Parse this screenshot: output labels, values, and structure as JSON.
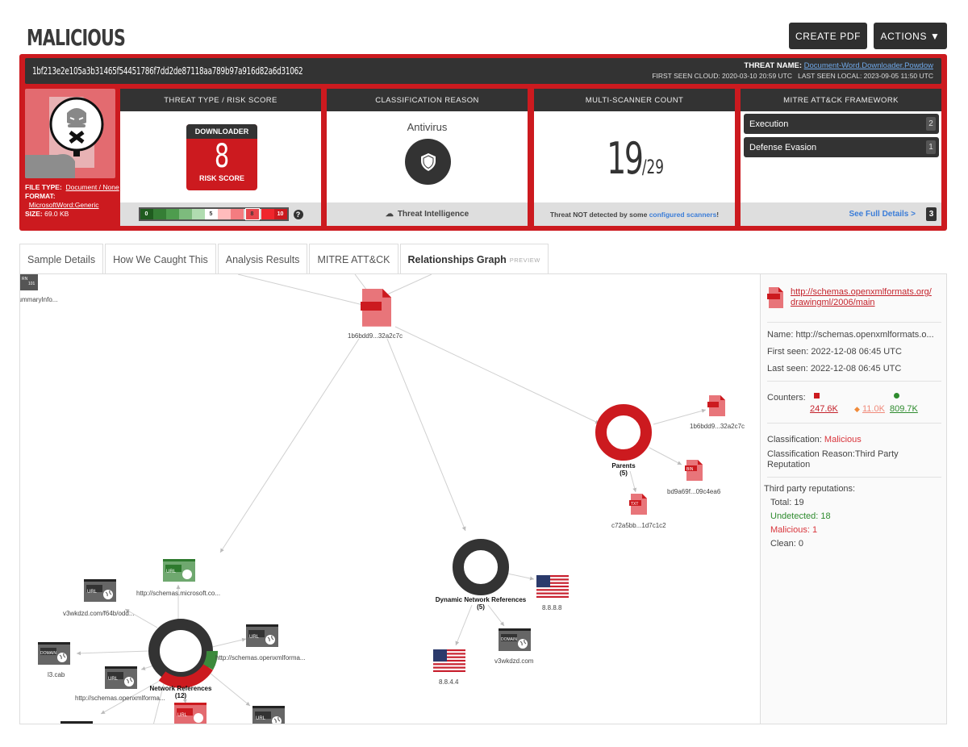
{
  "page": {
    "title": "MALICIOUS",
    "buttons": {
      "create_pdf": "CREATE PDF",
      "actions": "ACTIONS ▼"
    }
  },
  "threat": {
    "hash": "1bf213e2e105a3b31465f54451786f7dd2de87118aa789b97a916d82a6d31062",
    "threat_name_label": "THREAT NAME:",
    "threat_name": "Document-Word.Downloader.Powdow",
    "first_seen": "FIRST SEEN CLOUD: 2020-03-10 20:59 UTC",
    "last_seen": "LAST SEEN LOCAL: 2023-09-05 11:50 UTC",
    "file_type_label": "FILE TYPE:",
    "file_type": "Document / None",
    "format_label": "FORMAT:",
    "format": "MicrosoftWord:Generic",
    "size_label": "SIZE:",
    "size": "69.0 KB"
  },
  "panels": {
    "risk": {
      "header": "THREAT TYPE / RISK SCORE",
      "type": "DOWNLOADER",
      "score": "8",
      "score_label": "RISK SCORE",
      "scale": [
        {
          "label": "0",
          "color": "#1f5c1f"
        },
        {
          "label": "",
          "color": "#357e35"
        },
        {
          "label": "",
          "color": "#4e9c4e"
        },
        {
          "label": "",
          "color": "#7dbb7d"
        },
        {
          "label": "",
          "color": "#b0dcb0"
        },
        {
          "label": "5",
          "color": "#ffffff"
        },
        {
          "label": "",
          "color": "#ffbcbc"
        },
        {
          "label": "",
          "color": "#f47c80"
        },
        {
          "label": "8",
          "color": "#e8474d"
        },
        {
          "label": "",
          "color": "#f0262c"
        },
        {
          "label": "10",
          "color": "#cc1a1f"
        }
      ],
      "help": "?"
    },
    "classification": {
      "header": "CLASSIFICATION REASON",
      "reason": "Antivirus",
      "footer": "Threat Intelligence"
    },
    "scanner": {
      "header": "MULTI-SCANNER COUNT",
      "detected": "19",
      "total": "/29",
      "footer_text": "Threat NOT detected by some ",
      "footer_link": "configured scanners",
      "footer_end": "!"
    },
    "mitre": {
      "header": "MITRE ATT&CK FRAMEWORK",
      "items": [
        {
          "label": "Execution",
          "count": "2"
        },
        {
          "label": "Defense Evasion",
          "count": "1"
        }
      ],
      "see_full": "See Full Details >",
      "total": "3"
    }
  },
  "tabs": [
    {
      "label": "Sample Details",
      "active": false
    },
    {
      "label": "How We Caught This",
      "active": false
    },
    {
      "label": "Analysis Results",
      "active": false
    },
    {
      "label": "MITRE ATT&CK",
      "active": false
    },
    {
      "label": "Relationships Graph",
      "badge": "PREVIEW",
      "active": true
    }
  ],
  "graph": {
    "nodes": {
      "corner": "tSummaryInfo...",
      "root": "1b6bdd9...32a2c7c",
      "parents_title": "Parents",
      "parents_count": "(5)",
      "parent_child_1": "1b6bdd9...32a2c7c",
      "parent_child_2": "bd9a69f...09c4ea6",
      "parent_child_3": "c72a5bb...1d7c1c2",
      "dyn_title": "Dynamic Network References",
      "dyn_count": "(5)",
      "dyn_ip1": "8.8.8.8",
      "dyn_ip2": "8.8.4.4",
      "dyn_domain": "v3wkdzd.com",
      "net_title": "Network References",
      "net_count": "(12)",
      "net_url_ms": "http://schemas.microsoft.co...",
      "net_url_v3": "v3wkdzd.com/f64b/odd...",
      "net_url_oxml1": "http://schemas.openxmlforma...",
      "net_domain_cab": "l3.cab",
      "net_url_oxml2": "http://schemas.openxmlforma..."
    },
    "icon_labels": {
      "url": "URL",
      "domain": "DOMAIN",
      "bin": "BIN",
      "txt": "TXT"
    }
  },
  "sidebar": {
    "link": "http://schemas.openxmlformats.org/drawingml/2006/main",
    "link_line1": "http://schemas.openxmlformats.org/",
    "link_line2": "drawingml/2006/main",
    "name": "Name: http://schemas.openxmlformats.o...",
    "first_seen": "First seen: 2022-12-08 06:45 UTC",
    "last_seen": "Last seen: 2022-12-08 06:45 UTC",
    "counters_label": "Counters:",
    "counters": {
      "malicious": "247.6K",
      "suspicious": "11.0K",
      "known": "809.7K"
    },
    "classification_label": "Classification:",
    "classification": "Malicious",
    "classification_reason": "Classification Reason:Third Party Reputation",
    "reputations_label": "Third party reputations:",
    "total": "Total: 19",
    "undetected": "Undetected: 18",
    "malicious": "Malicious: 1",
    "clean": "Clean: 0"
  }
}
